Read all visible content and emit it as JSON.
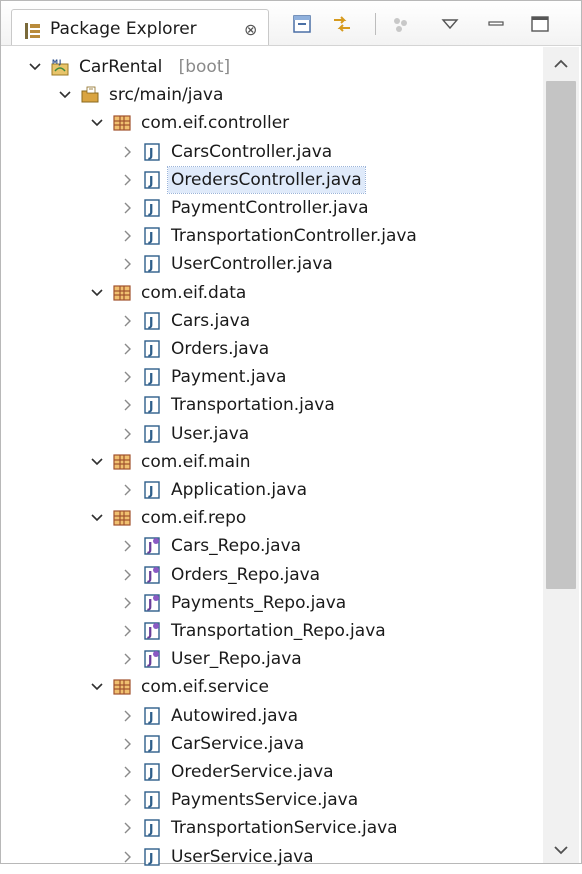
{
  "view": {
    "title": "Package Explorer",
    "close_glyph": "⊗"
  },
  "toolbar": {
    "buttons": [
      "collapse-all-icon",
      "link-with-editor-icon",
      "focus-icon",
      "view-menu-icon",
      "minimize-icon",
      "maximize-icon"
    ]
  },
  "tree": {
    "project": {
      "name": "CarRental",
      "decoration": "[boot]"
    },
    "source_folder": "src/main/java",
    "packages": [
      {
        "name": "com.eif.controller",
        "files": [
          {
            "name": "CarsController.java",
            "kind": "class"
          },
          {
            "name": "OredersController.java",
            "kind": "class",
            "selected": true
          },
          {
            "name": "PaymentController.java",
            "kind": "class"
          },
          {
            "name": "TransportationController.java",
            "kind": "class"
          },
          {
            "name": "UserController.java",
            "kind": "class"
          }
        ]
      },
      {
        "name": "com.eif.data",
        "files": [
          {
            "name": "Cars.java",
            "kind": "class"
          },
          {
            "name": "Orders.java",
            "kind": "class"
          },
          {
            "name": "Payment.java",
            "kind": "class"
          },
          {
            "name": "Transportation.java",
            "kind": "class"
          },
          {
            "name": "User.java",
            "kind": "class"
          }
        ]
      },
      {
        "name": "com.eif.main",
        "files": [
          {
            "name": "Application.java",
            "kind": "class"
          }
        ]
      },
      {
        "name": "com.eif.repo",
        "files": [
          {
            "name": "Cars_Repo.java",
            "kind": "interface"
          },
          {
            "name": "Orders_Repo.java",
            "kind": "interface"
          },
          {
            "name": "Payments_Repo.java",
            "kind": "interface"
          },
          {
            "name": "Transportation_Repo.java",
            "kind": "interface"
          },
          {
            "name": "User_Repo.java",
            "kind": "interface"
          }
        ]
      },
      {
        "name": "com.eif.service",
        "files": [
          {
            "name": "Autowired.java",
            "kind": "class"
          },
          {
            "name": "CarService.java",
            "kind": "class"
          },
          {
            "name": "OrederService.java",
            "kind": "class"
          },
          {
            "name": "PaymentsService.java",
            "kind": "class"
          },
          {
            "name": "TransportationService.java",
            "kind": "class"
          },
          {
            "name": "UserService.java",
            "kind": "class"
          }
        ]
      }
    ]
  },
  "colors": {
    "package_icon": "#a0522d",
    "java_file_icon": "#2e5e8a",
    "selection": "#dfeafa",
    "source_folder_icon": "#d9a441"
  }
}
